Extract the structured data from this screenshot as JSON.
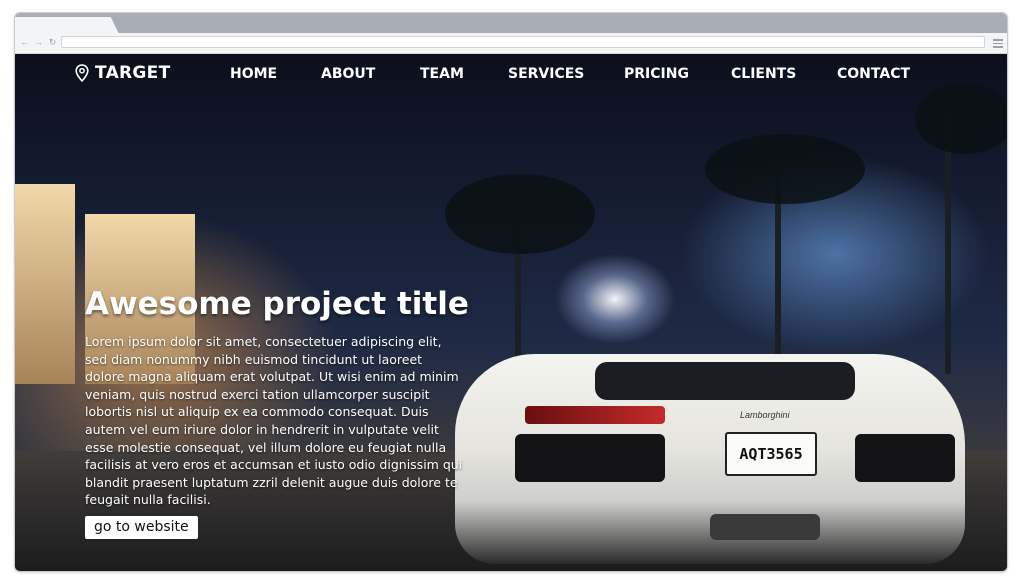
{
  "brand": {
    "name": "TARGET",
    "icon": "location-pin-icon"
  },
  "nav": {
    "items": [
      "HOME",
      "ABOUT",
      "TEAM",
      "SERVICES",
      "PRICING",
      "CLIENTS",
      "CONTACT"
    ]
  },
  "hero": {
    "title": "Awesome project title",
    "body": "Lorem ipsum dolor sit amet, consectetuer adipiscing elit, sed diam nonummy nibh euismod tincidunt ut laoreet dolore magna aliquam erat volutpat. Ut wisi enim ad minim veniam, quis nostrud exerci tation ullamcorper suscipit lobortis nisl ut aliquip ex ea commodo consequat. Duis autem vel eum iriure dolor in hendrerit in vulputate velit esse molestie consequat, vel illum dolore eu feugiat nulla facilisis at vero eros et accumsan et iusto odio dignissim qui blandit praesent luptatum zzril delenit augue duis dolore te feugait nulla facilisi.",
    "button_label": "go to website",
    "car_plate": "AQT3565",
    "car_badge": "Lamborghini"
  },
  "browser": {
    "back_icon": "back-arrow-icon",
    "forward_icon": "forward-arrow-icon",
    "reload_icon": "reload-icon",
    "menu_icon": "hamburger-menu-icon"
  }
}
